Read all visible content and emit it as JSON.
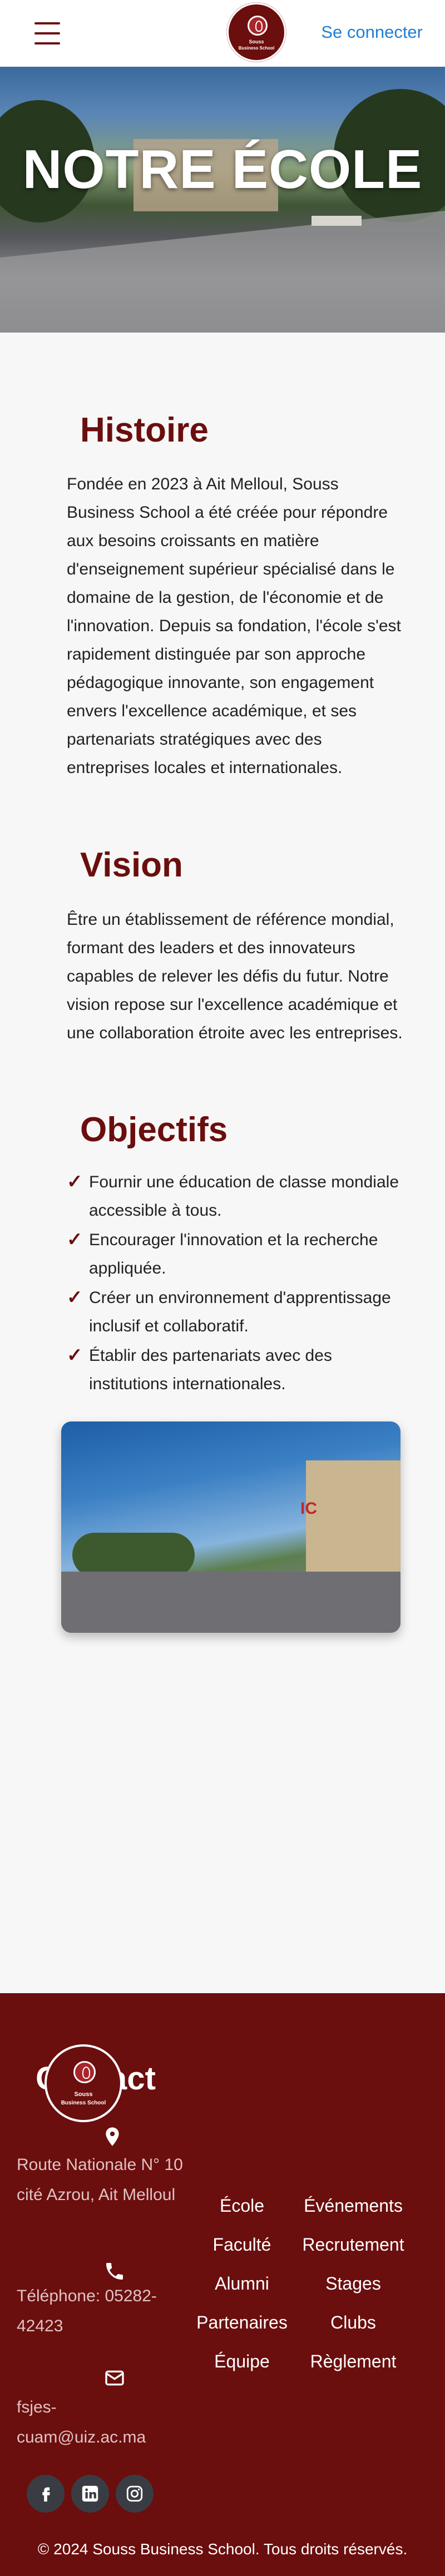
{
  "header": {
    "logo_line1": "Souss",
    "logo_line2": "Business School",
    "login_label": "Se connecter"
  },
  "hero": {
    "title": "NOTRE ÉCOLE"
  },
  "histoire": {
    "title": "Histoire",
    "text": "Fondée en 2023 à Ait Melloul, Souss Business School a été créée pour répondre aux besoins croissants en matière d'enseignement supérieur spécialisé dans le domaine de la gestion, de l'économie et de l'innovation. Depuis sa fondation, l'école s'est rapidement distinguée par son approche pédagogique innovante, son engagement envers l'excellence académique, et ses partenariats stratégiques avec des entreprises locales et internationales."
  },
  "vision": {
    "title": "Vision",
    "text": "Être un établissement de référence mondial, formant des leaders et des innovateurs capables de relever les défis du futur. Notre vision repose sur l'excellence académique et une collaboration étroite avec les entreprises."
  },
  "objectifs": {
    "title": "Objectifs",
    "check_symbol": "✓",
    "items": [
      "Fournir une éducation de classe mondiale accessible à tous.",
      "Encourager l'innovation et la recherche appliquée.",
      "Créer un environnement d'apprentissage inclusif et collaboratif.",
      "Établir des partenariats avec des institutions internationales."
    ]
  },
  "photo": {
    "sign_text": "IC"
  },
  "footer": {
    "title": "Contact",
    "address": "Route Nationale N° 10 cité Azrou, Ait Melloul",
    "phone": "Téléphone: 05282-42423",
    "email": "fsjes-cuam@uiz.ac.ma",
    "links": [
      "École",
      "Événements",
      "Faculté",
      "Recrutement",
      "Alumni",
      "Stages",
      "Partenaires",
      "Clubs",
      "Équipe",
      "Règlement"
    ],
    "social_icons": [
      "facebook-icon",
      "linkedin-icon",
      "instagram-icon"
    ],
    "copyright": "© 2024 Souss Business School. Tous droits réservés."
  },
  "colors": {
    "brand": "#6b0e0e",
    "link_blue": "#1f7fd6",
    "page_bg": "#f7f7f7"
  }
}
